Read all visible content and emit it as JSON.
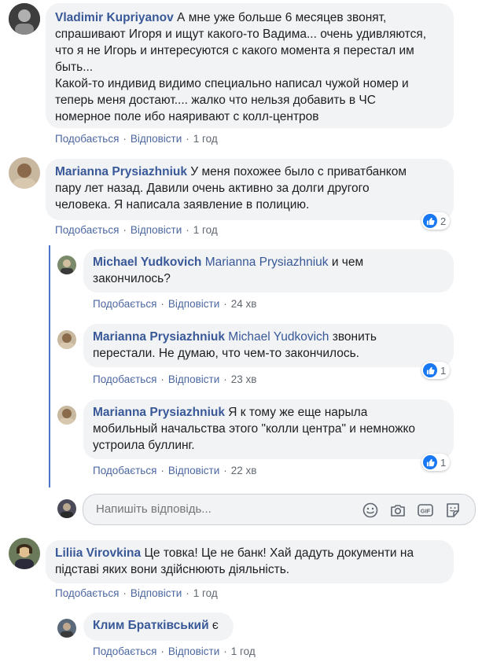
{
  "comments": [
    {
      "author": "Vladimir Kupriyanov",
      "lines": [
        "А мне уже больше 6 месяцев звонят,",
        "спрашивают Игоря и ищут какого-то Вадима... очень удивляются,",
        "что я не Игорь и интересуются с какого момента я перестал им",
        "быть...",
        "Какой-то индивид видимо специально написал чужой номер и",
        "теперь меня достают.... жалко что нельзя добавить в ЧС",
        "номерное поле ибо наяривают с колл-центров"
      ],
      "like": "Подобається",
      "reply": "Відповісти",
      "time": "1 год"
    },
    {
      "author": "Marianna Prysiazhniuk",
      "lines": [
        "У меня похожее было с приватбанком",
        "пару лет назад. Давили очень активно за долги другого",
        "человека. Я написала заявление в полицию."
      ],
      "like": "Подобається",
      "reply": "Відповісти",
      "time": "1 год",
      "reactions": "2"
    },
    {
      "author": "Michael Yudkovich",
      "mention": "Marianna Prysiazhniuk",
      "lines": [
        "и чем",
        "закончилось?"
      ],
      "like": "Подобається",
      "reply": "Відповісти",
      "time": "24 хв"
    },
    {
      "author": "Marianna Prysiazhniuk",
      "mention": "Michael Yudkovich",
      "lines": [
        "звонить",
        "перестали. Не думаю, что чем-то закончилось."
      ],
      "like": "Подобається",
      "reply": "Відповісти",
      "time": "23 хв",
      "reactions": "1"
    },
    {
      "author": "Marianna Prysiazhniuk",
      "lines": [
        "Я к тому же еще нарыла",
        "мобильный начальства этого \"колли центра\" и немножко",
        "устроила буллинг."
      ],
      "like": "Подобається",
      "reply": "Відповісти",
      "time": "22 хв",
      "reactions": "1"
    },
    {
      "author": "Liliia Virovkina",
      "lines": [
        "Це товка! Це не банк! Хай дадуть документи на",
        "підставі яких вони здійснюють діяльність."
      ],
      "like": "Подобається",
      "reply": "Відповісти",
      "time": "1 год"
    },
    {
      "author": "Клим Братківський",
      "lines": [
        "є"
      ],
      "like": "Подобається",
      "reply": "Відповісти",
      "time": "1 год"
    }
  ],
  "reply_box": {
    "placeholder": "Напишіть відповідь..."
  },
  "icons": {
    "emoji": "smiley-icon",
    "camera": "camera-icon",
    "gif": "GIF",
    "sticker": "sticker-icon"
  },
  "colors": {
    "link": "#385898",
    "bubble": "#f2f3f5",
    "like_blue": "#1877f2",
    "thread_line": "#4a76c8"
  }
}
